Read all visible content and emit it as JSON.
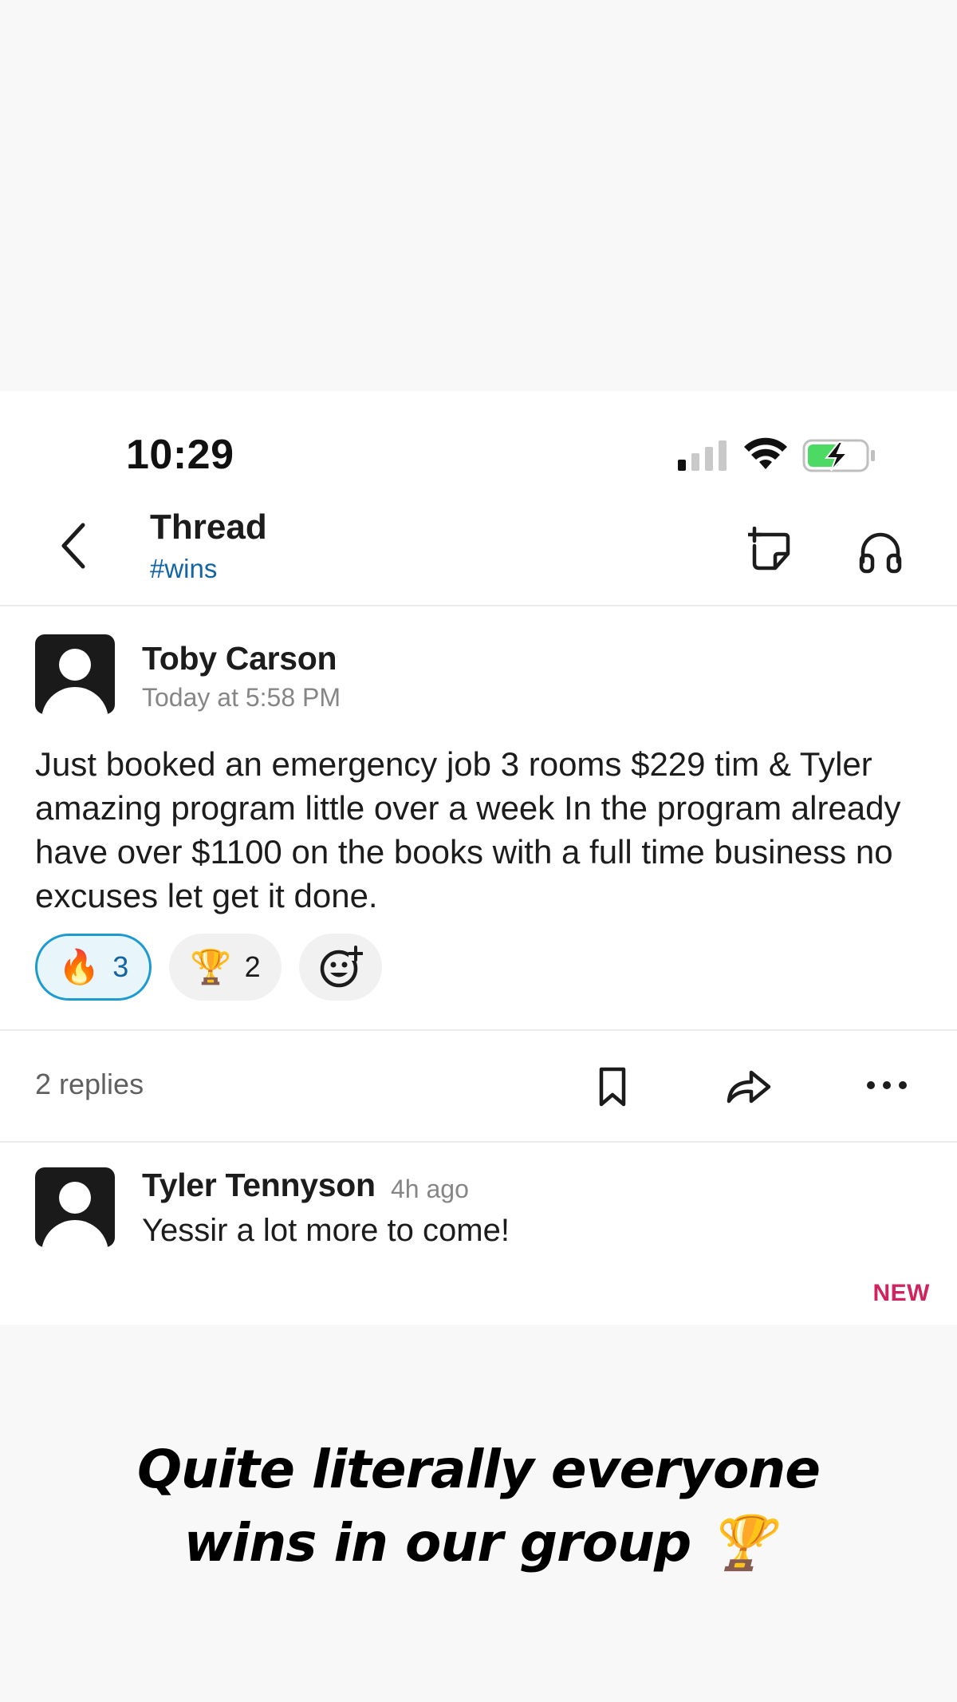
{
  "status_bar": {
    "time": "10:29",
    "signal_bars_active": 1,
    "signal_bars_total": 4,
    "battery_charging": true,
    "battery_level": 0.55
  },
  "header": {
    "title": "Thread",
    "channel": "#wins",
    "back_icon": "chevron-left-icon",
    "new_note_icon": "new-note-icon",
    "huddle_icon": "headphones-icon"
  },
  "message": {
    "author": "Toby Carson",
    "timestamp": "Today at 5:58 PM",
    "text": "Just booked an emergency job 3 rooms $229 tim & Tyler amazing program little over a week In the program already have over $1100 on the books with a full time business no excuses let get it done.",
    "reactions": [
      {
        "emoji": "🔥",
        "count": "3",
        "active": true
      },
      {
        "emoji": "🏆",
        "count": "2",
        "active": false
      }
    ],
    "add_reaction_icon": "add-reaction-icon"
  },
  "thread_actions": {
    "replies_label": "2 replies",
    "bookmark_icon": "bookmark-icon",
    "share_icon": "share-icon",
    "more_icon": "more-icon"
  },
  "reply": {
    "author": "Tyler Tennyson",
    "timestamp": "4h ago",
    "text": "Yessir a lot more to come!",
    "new_label": "NEW"
  },
  "caption": {
    "line1": "Quite literally everyone",
    "line2": "wins in our group 🏆"
  },
  "colors": {
    "link_blue": "#1264a3",
    "reaction_border": "#1d9bd1",
    "new_red": "#d0245e",
    "battery_green": "#4cd964"
  }
}
